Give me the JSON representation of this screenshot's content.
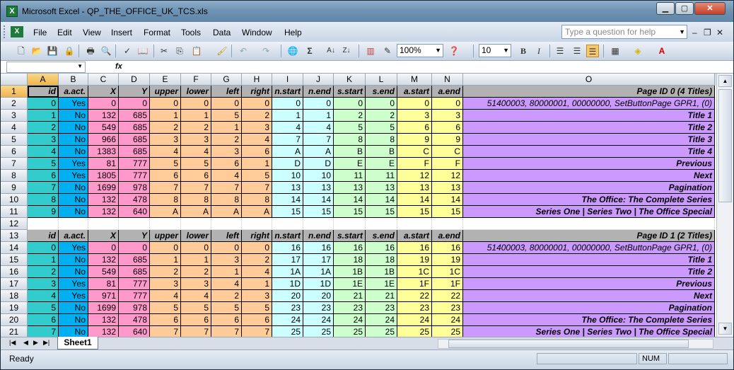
{
  "window": {
    "title": "Microsoft Excel - QP_THE_OFFICE_UK_TCS.xls"
  },
  "menu": {
    "items": [
      "File",
      "Edit",
      "View",
      "Insert",
      "Format",
      "Tools",
      "Data",
      "Window",
      "Help"
    ],
    "help_placeholder": "Type a question for help"
  },
  "toolbar": {
    "zoom": "100%",
    "font_size": "10"
  },
  "formula_bar": {
    "name_box": "",
    "fx": "fx",
    "formula": ""
  },
  "columns": [
    "A",
    "B",
    "C",
    "D",
    "E",
    "F",
    "G",
    "H",
    "I",
    "J",
    "K",
    "L",
    "M",
    "N",
    "O"
  ],
  "header_labels": [
    "id",
    "a.act.",
    "X",
    "Y",
    "upper",
    "lower",
    "left",
    "right",
    "n.start",
    "n.end",
    "s.start",
    "s.end",
    "a.start",
    "a.end"
  ],
  "rows": [
    {
      "n": "1",
      "hdr": true,
      "o": "Page ID 0 (4 Titles)"
    },
    {
      "n": "2",
      "v": [
        "0",
        "Yes",
        "0",
        "0",
        "0",
        "0",
        "0",
        "0",
        "0",
        "0",
        "0",
        "0",
        "0",
        "0"
      ],
      "o": "51400003, 80000001, 00000000, SetButtonPage GPR1, (0)",
      "plain": true
    },
    {
      "n": "3",
      "v": [
        "1",
        "No",
        "132",
        "685",
        "1",
        "1",
        "5",
        "2",
        "1",
        "1",
        "2",
        "2",
        "3",
        "3"
      ],
      "o": "Title 1"
    },
    {
      "n": "4",
      "v": [
        "2",
        "No",
        "549",
        "685",
        "2",
        "2",
        "1",
        "3",
        "4",
        "4",
        "5",
        "5",
        "6",
        "6"
      ],
      "o": "Title 2"
    },
    {
      "n": "5",
      "v": [
        "3",
        "No",
        "966",
        "685",
        "3",
        "3",
        "2",
        "4",
        "7",
        "7",
        "8",
        "8",
        "9",
        "9"
      ],
      "o": "Title 3"
    },
    {
      "n": "6",
      "v": [
        "4",
        "No",
        "1383",
        "685",
        "4",
        "4",
        "3",
        "6",
        "A",
        "A",
        "B",
        "B",
        "C",
        "C"
      ],
      "o": "Title 4"
    },
    {
      "n": "7",
      "v": [
        "5",
        "Yes",
        "81",
        "777",
        "5",
        "5",
        "6",
        "1",
        "D",
        "D",
        "E",
        "E",
        "F",
        "F"
      ],
      "o": "Previous"
    },
    {
      "n": "8",
      "v": [
        "6",
        "Yes",
        "1805",
        "777",
        "6",
        "6",
        "4",
        "5",
        "10",
        "10",
        "11",
        "11",
        "12",
        "12"
      ],
      "o": "Next"
    },
    {
      "n": "9",
      "v": [
        "7",
        "No",
        "1699",
        "978",
        "7",
        "7",
        "7",
        "7",
        "13",
        "13",
        "13",
        "13",
        "13",
        "13"
      ],
      "o": "Pagination"
    },
    {
      "n": "10",
      "v": [
        "8",
        "No",
        "132",
        "478",
        "8",
        "8",
        "8",
        "8",
        "14",
        "14",
        "14",
        "14",
        "14",
        "14"
      ],
      "o": "The Office: The Complete Series"
    },
    {
      "n": "11",
      "v": [
        "9",
        "No",
        "132",
        "640",
        "A",
        "A",
        "A",
        "A",
        "15",
        "15",
        "15",
        "15",
        "15",
        "15"
      ],
      "o": "Series One | Series Two | The Office Special"
    },
    {
      "n": "12",
      "empty": true
    },
    {
      "n": "13",
      "hdr": true,
      "o": "Page ID 1 (2 Titles)"
    },
    {
      "n": "14",
      "v": [
        "0",
        "Yes",
        "0",
        "0",
        "0",
        "0",
        "0",
        "0",
        "16",
        "16",
        "16",
        "16",
        "16",
        "16"
      ],
      "o": "51400003, 80000001, 00000000, SetButtonPage GPR1, (0)",
      "plain": true
    },
    {
      "n": "15",
      "v": [
        "1",
        "No",
        "132",
        "685",
        "1",
        "1",
        "3",
        "2",
        "17",
        "17",
        "18",
        "18",
        "19",
        "19"
      ],
      "o": "Title 1"
    },
    {
      "n": "16",
      "v": [
        "2",
        "No",
        "549",
        "685",
        "2",
        "2",
        "1",
        "4",
        "1A",
        "1A",
        "1B",
        "1B",
        "1C",
        "1C"
      ],
      "o": "Title 2"
    },
    {
      "n": "17",
      "v": [
        "3",
        "Yes",
        "81",
        "777",
        "3",
        "3",
        "4",
        "1",
        "1D",
        "1D",
        "1E",
        "1E",
        "1F",
        "1F"
      ],
      "o": "Previous"
    },
    {
      "n": "18",
      "v": [
        "4",
        "Yes",
        "971",
        "777",
        "4",
        "4",
        "2",
        "3",
        "20",
        "20",
        "21",
        "21",
        "22",
        "22"
      ],
      "o": "Next"
    },
    {
      "n": "19",
      "v": [
        "5",
        "No",
        "1699",
        "978",
        "5",
        "5",
        "5",
        "5",
        "23",
        "23",
        "23",
        "23",
        "23",
        "23"
      ],
      "o": "Pagination"
    },
    {
      "n": "20",
      "v": [
        "6",
        "No",
        "132",
        "478",
        "6",
        "6",
        "6",
        "6",
        "24",
        "24",
        "24",
        "24",
        "24",
        "24"
      ],
      "o": "The Office: The Complete Series"
    },
    {
      "n": "21",
      "v": [
        "7",
        "No",
        "132",
        "640",
        "7",
        "7",
        "7",
        "7",
        "25",
        "25",
        "25",
        "25",
        "25",
        "25"
      ],
      "o": "Series One | Series Two | The Office Special"
    }
  ],
  "sheet_tab": "Sheet1",
  "status": {
    "text": "Ready",
    "num": "NUM"
  }
}
